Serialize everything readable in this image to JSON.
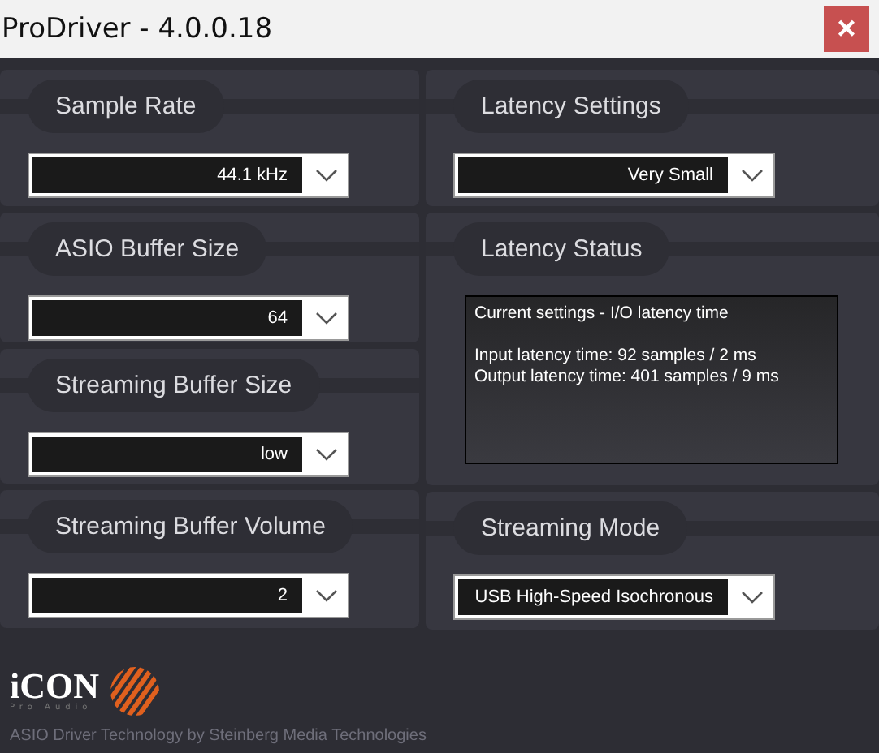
{
  "window": {
    "title": "ProDriver - 4.0.0.18",
    "close": "×"
  },
  "left": [
    {
      "title": "Sample Rate",
      "value": "44.1 kHz"
    },
    {
      "title": "ASIO Buffer Size",
      "value": "64"
    },
    {
      "title": "Streaming Buffer Size",
      "value": "low"
    },
    {
      "title": "Streaming Buffer Volume",
      "value": "2"
    }
  ],
  "right": [
    {
      "kind": "dropdown",
      "title": "Latency Settings",
      "value": "Very Small"
    },
    {
      "kind": "status",
      "title": "Latency Status",
      "heading": "Current settings - I/O latency time",
      "lines": [
        "Input latency time: 92 samples / 2 ms",
        "Output latency time: 401 samples / 9 ms"
      ]
    },
    {
      "kind": "dropdown",
      "title": "Streaming Mode",
      "value": "USB High-Speed Isochronous"
    }
  ],
  "logo": {
    "name": "iCON",
    "tagline": "Pro Audio"
  },
  "footer": "ASIO Driver Technology by Steinberg Media Technologies"
}
